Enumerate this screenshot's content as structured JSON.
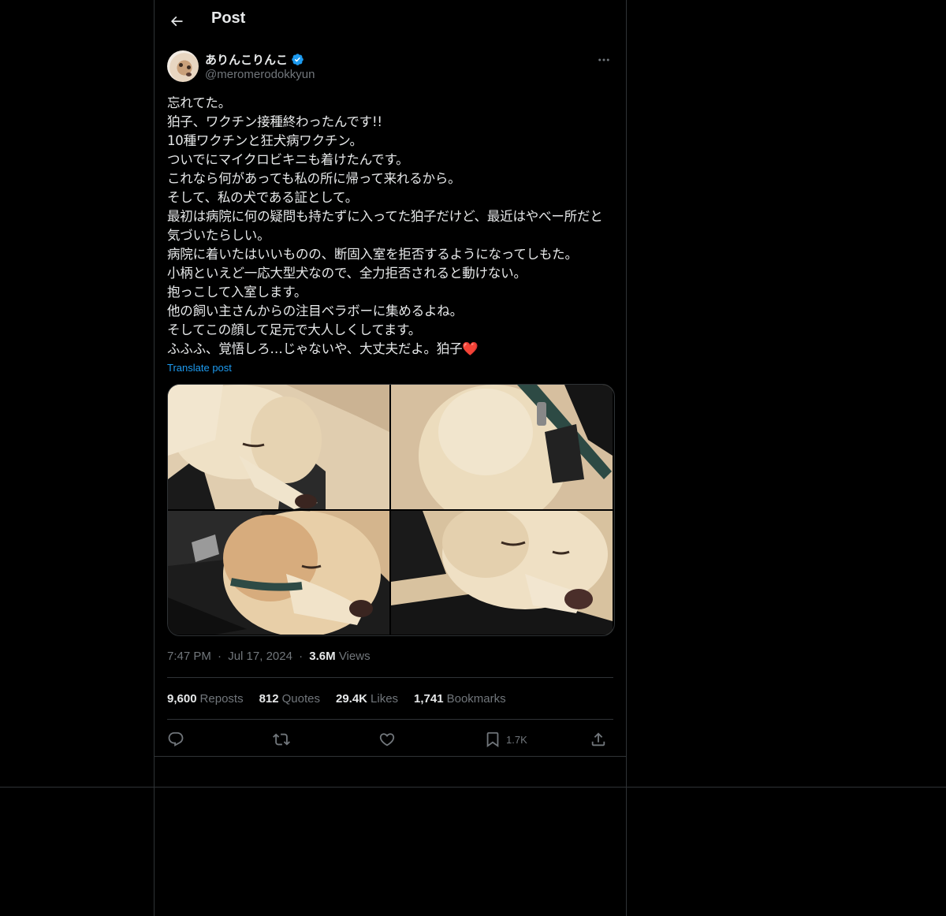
{
  "header": {
    "title": "Post",
    "back_icon": "arrow-left-icon"
  },
  "author": {
    "display_name": "ありんこりんこ",
    "handle": "@meromerodokkyun",
    "verified": true,
    "verified_color": "#1d9bf0"
  },
  "tweet": {
    "text": "忘れてた。\n狛子、ワクチン接種終わったんです!!\n10種ワクチンと狂犬病ワクチン。\nついでにマイクロビキニも着けたんです。\nこれなら何があっても私の所に帰って来れるから。\nそして、私の犬である証として。\n最初は病院に何の疑問も持たずに入ってた狛子だけど、最近はやべー所だと気づいたらしい。\n病院に着いたはいいものの、断固入室を拒否するようになってしもた。\n小柄といえど一応大型犬なので、全力拒否されると動けない。\n抱っこして入室します。\n他の飼い主さんからの注目ベラボーに集めるよね。\nそしてこの顔して足元で大人しくしてます。\nふふふ、覚悟しろ…じゃないや、大丈夫だよ。狛子❤️",
    "translate_label": "Translate post"
  },
  "meta": {
    "time": "7:47 PM",
    "separator": "·",
    "date": "Jul 17, 2024",
    "views_count": "3.6M",
    "views_label": "Views"
  },
  "stats": {
    "reposts": {
      "count": "9,600",
      "label": "Reposts"
    },
    "quotes": {
      "count": "812",
      "label": "Quotes"
    },
    "likes": {
      "count": "29.4K",
      "label": "Likes"
    },
    "bookmarks": {
      "count": "1,741",
      "label": "Bookmarks"
    }
  },
  "actions": {
    "reply_icon": "reply-icon",
    "repost_icon": "repost-icon",
    "like_icon": "heart-icon",
    "bookmark_icon": "bookmark-icon",
    "bookmark_count": "1.7K",
    "share_icon": "share-icon"
  },
  "colors": {
    "background": "#000000",
    "text_primary": "#e7e9ea",
    "text_secondary": "#71767b",
    "accent": "#1d9bf0",
    "border": "#2f3336"
  }
}
